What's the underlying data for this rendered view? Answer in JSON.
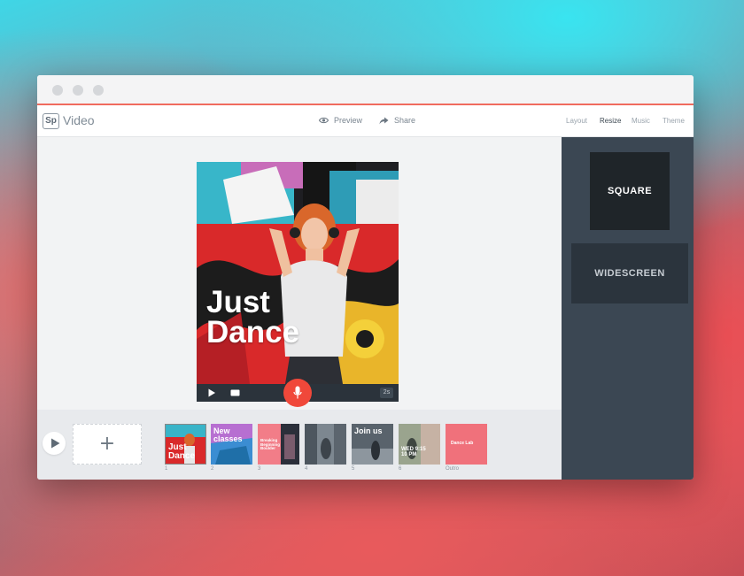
{
  "window": {
    "title_dots": [
      "close",
      "minimize",
      "maximize"
    ]
  },
  "app": {
    "logo": "Sp",
    "name": "Video"
  },
  "toolbar": {
    "preview_label": "Preview",
    "share_label": "Share"
  },
  "tabs": [
    {
      "label": "Layout",
      "active": false
    },
    {
      "label": "Resize",
      "active": true
    },
    {
      "label": "Music",
      "active": false
    },
    {
      "label": "Theme",
      "active": false
    }
  ],
  "preview": {
    "headline_line1": "Just",
    "headline_line2": "Dance",
    "duration": "2s"
  },
  "timeline": {
    "add_label": "+",
    "slides": [
      {
        "text": "Just Dance",
        "number": "1"
      },
      {
        "text": "New classes",
        "number": "2"
      },
      {
        "text": "Breaking Beginning Boulder",
        "number": "3"
      },
      {
        "text": "",
        "number": "4"
      },
      {
        "text": "Join us",
        "number": "5"
      },
      {
        "text": "WED 9:15 10 PM",
        "number": "6"
      },
      {
        "text": "Dance Lab",
        "number": "Outro"
      }
    ]
  },
  "resize_panel": {
    "square_label": "SQUARE",
    "widescreen_label": "WIDESCREEN"
  },
  "colors": {
    "accent": "#f0483a",
    "panel": "#3b4753",
    "card": "#1f2529"
  }
}
